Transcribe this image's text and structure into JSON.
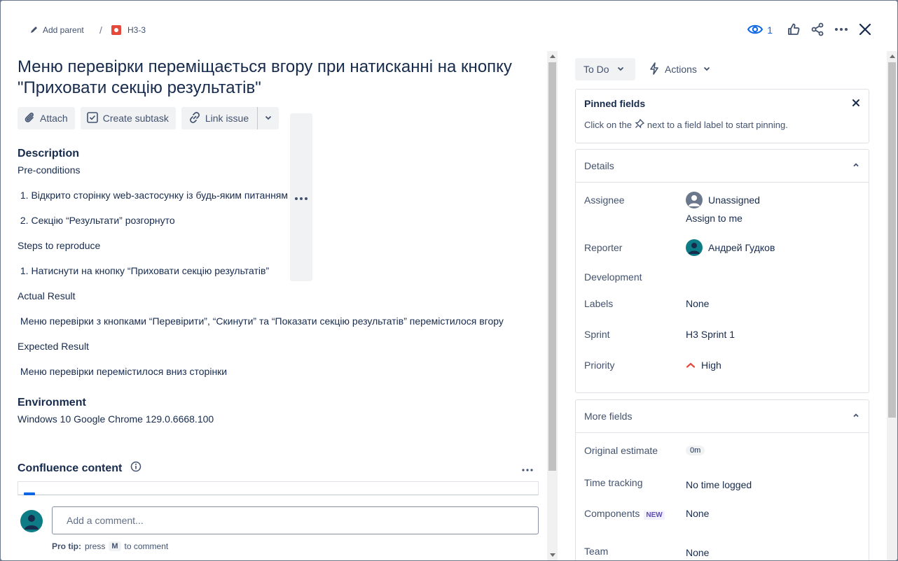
{
  "breadcrumb": {
    "add_parent": "Add parent",
    "separator": "/",
    "issue_key": "H3-3"
  },
  "header": {
    "watch_count": "1"
  },
  "issue": {
    "title": "Меню перевірки переміщається вгору при натисканні на кнопку \"Приховати секцію результатів\""
  },
  "toolbar": {
    "attach": "Attach",
    "create_subtask": "Create subtask",
    "link_issue": "Link issue"
  },
  "description": {
    "heading": "Description",
    "lines": [
      "Pre-conditions",
      " 1. Відкрито сторінку web-застосунку із будь-яким питанням",
      " 2. Секцію “Результати” розгорнуто",
      "Steps to reproduce",
      " 1. Натиснути на кнопку “Приховати секцію результатів”",
      "Actual Result",
      " Меню перевірки з кнопками “Перевірити”, “Скинути” та “Показати секцію результатів” перемістилося вгору",
      "Expected Result",
      " Меню перевірки перемістилося вниз сторінки"
    ]
  },
  "environment": {
    "heading": "Environment",
    "value": "Windows 10 Google Chrome 129.0.6668.100"
  },
  "confluence": {
    "heading": "Confluence content"
  },
  "comment": {
    "placeholder": "Add a comment...",
    "protip_label": "Pro tip:",
    "protip_press": "press",
    "protip_key": "M",
    "protip_rest": "to comment"
  },
  "status": {
    "current": "To Do",
    "actions": "Actions"
  },
  "pinned": {
    "heading": "Pinned fields",
    "text_before": "Click on the",
    "text_after": "next to a field label to start pinning."
  },
  "details": {
    "heading": "Details",
    "assignee_label": "Assignee",
    "assignee_value": "Unassigned",
    "assign_to_me": "Assign to me",
    "reporter_label": "Reporter",
    "reporter_value": "Андрей Гудков",
    "development_label": "Development",
    "labels_label": "Labels",
    "labels_value": "None",
    "sprint_label": "Sprint",
    "sprint_value": "H3 Sprint 1",
    "priority_label": "Priority",
    "priority_value": "High"
  },
  "more_fields": {
    "heading": "More fields",
    "original_estimate_label": "Original estimate",
    "original_estimate_value": "0m",
    "time_tracking_label": "Time tracking",
    "time_tracking_value": "No time logged",
    "components_label": "Components",
    "components_badge": "NEW",
    "components_value": "None",
    "team_label": "Team",
    "team_value": "None"
  },
  "colors": {
    "accent": "#0c66e4",
    "priority_high": "#e5493a",
    "bug": "#e5493a",
    "avatar": "#0e7c86"
  }
}
